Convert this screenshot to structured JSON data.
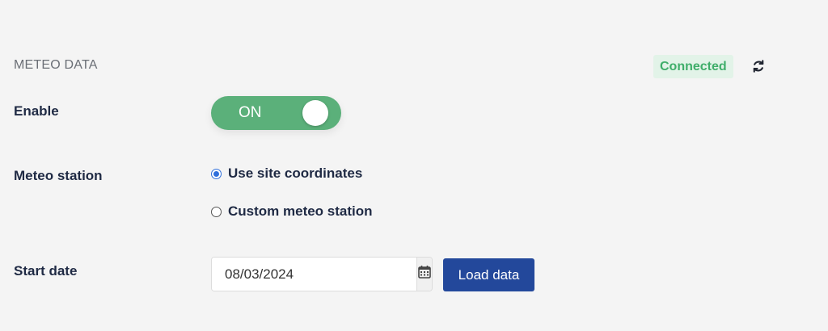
{
  "section": {
    "title": "METEO DATA"
  },
  "status": {
    "text": "Connected",
    "icon": "refresh-icon"
  },
  "enable": {
    "label": "Enable",
    "toggle_text": "ON",
    "toggle_on": true
  },
  "meteo_station": {
    "label": "Meteo station",
    "options": [
      {
        "label": "Use site coordinates",
        "checked": true
      },
      {
        "label": "Custom meteo station",
        "checked": false
      }
    ]
  },
  "start_date": {
    "label": "Start date",
    "value": "08/03/2024",
    "icon": "calendar-icon"
  },
  "load_button": {
    "label": "Load data"
  },
  "colors": {
    "accent_green": "#5bb07a",
    "status_green": "#3fae6a",
    "primary_blue": "#23489b",
    "radio_blue": "#2f6fdb"
  }
}
